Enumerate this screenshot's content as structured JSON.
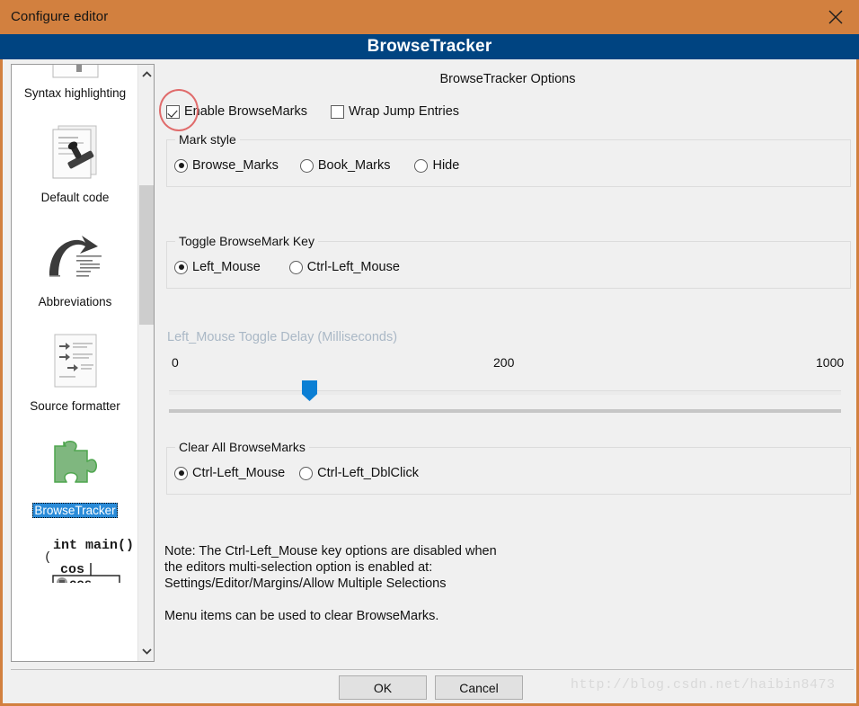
{
  "window": {
    "title": "Configure editor",
    "close_icon": "close-icon",
    "header_title": "BrowseTracker",
    "colors": {
      "titlebar": "#d2803f",
      "header": "#004481",
      "selection": "#2a8bd8",
      "slider_thumb": "#0b7fd4",
      "annotation": "#e06b6b",
      "disabled_label": "#aab8c6"
    }
  },
  "sidebar": {
    "scroll_up_icon": "chevron-up-icon",
    "scroll_down_icon": "chevron-down-icon",
    "items": [
      {
        "label": "Syntax highlighting",
        "icon": "syntax-highlighting-icon",
        "selected": false
      },
      {
        "label": "Default code",
        "icon": "default-code-stamp-icon",
        "selected": false
      },
      {
        "label": "Abbreviations",
        "icon": "abbreviations-arrow-icon",
        "selected": false
      },
      {
        "label": "Source formatter",
        "icon": "source-formatter-document-icon",
        "selected": false
      },
      {
        "label": "BrowseTracker",
        "icon": "puzzle-piece-icon",
        "selected": true
      },
      {
        "label": "",
        "icon": "code-completion-icon",
        "selected": false
      }
    ]
  },
  "main": {
    "options_title": "BrowseTracker Options",
    "checkboxes": [
      {
        "label": "Enable BrowseMarks",
        "checked": true
      },
      {
        "label": "Wrap Jump Entries",
        "checked": false
      }
    ],
    "mark_style": {
      "legend": "Mark style",
      "options": [
        {
          "label": "Browse_Marks",
          "checked": true
        },
        {
          "label": "Book_Marks",
          "checked": false
        },
        {
          "label": "Hide",
          "checked": false
        }
      ]
    },
    "toggle_key": {
      "legend": "Toggle BrowseMark Key",
      "options": [
        {
          "label": "Left_Mouse",
          "checked": true
        },
        {
          "label": "Ctrl-Left_Mouse",
          "checked": false
        }
      ]
    },
    "delay_slider": {
      "label": "Left_Mouse Toggle Delay (Milliseconds)",
      "disabled": true,
      "min_tick": "0",
      "mid_tick": "200",
      "max_tick": "1000",
      "value": 200,
      "min": 0,
      "max": 1000
    },
    "clear_all": {
      "legend": "Clear All BrowseMarks",
      "options": [
        {
          "label": "Ctrl-Left_Mouse",
          "checked": true
        },
        {
          "label": "Ctrl-Left_DblClick",
          "checked": false
        }
      ]
    },
    "note_line1": "Note: The Ctrl-Left_Mouse key options are disabled when",
    "note_line2": "the editors multi-selection option is enabled at:",
    "note_line3": "Settings/Editor/Margins/Allow Multiple Selections",
    "note_line4": "Menu items can be used to clear BrowseMarks."
  },
  "footer": {
    "ok_label": "OK",
    "cancel_label": "Cancel",
    "watermark": "http://blog.csdn.net/haibin8473"
  }
}
